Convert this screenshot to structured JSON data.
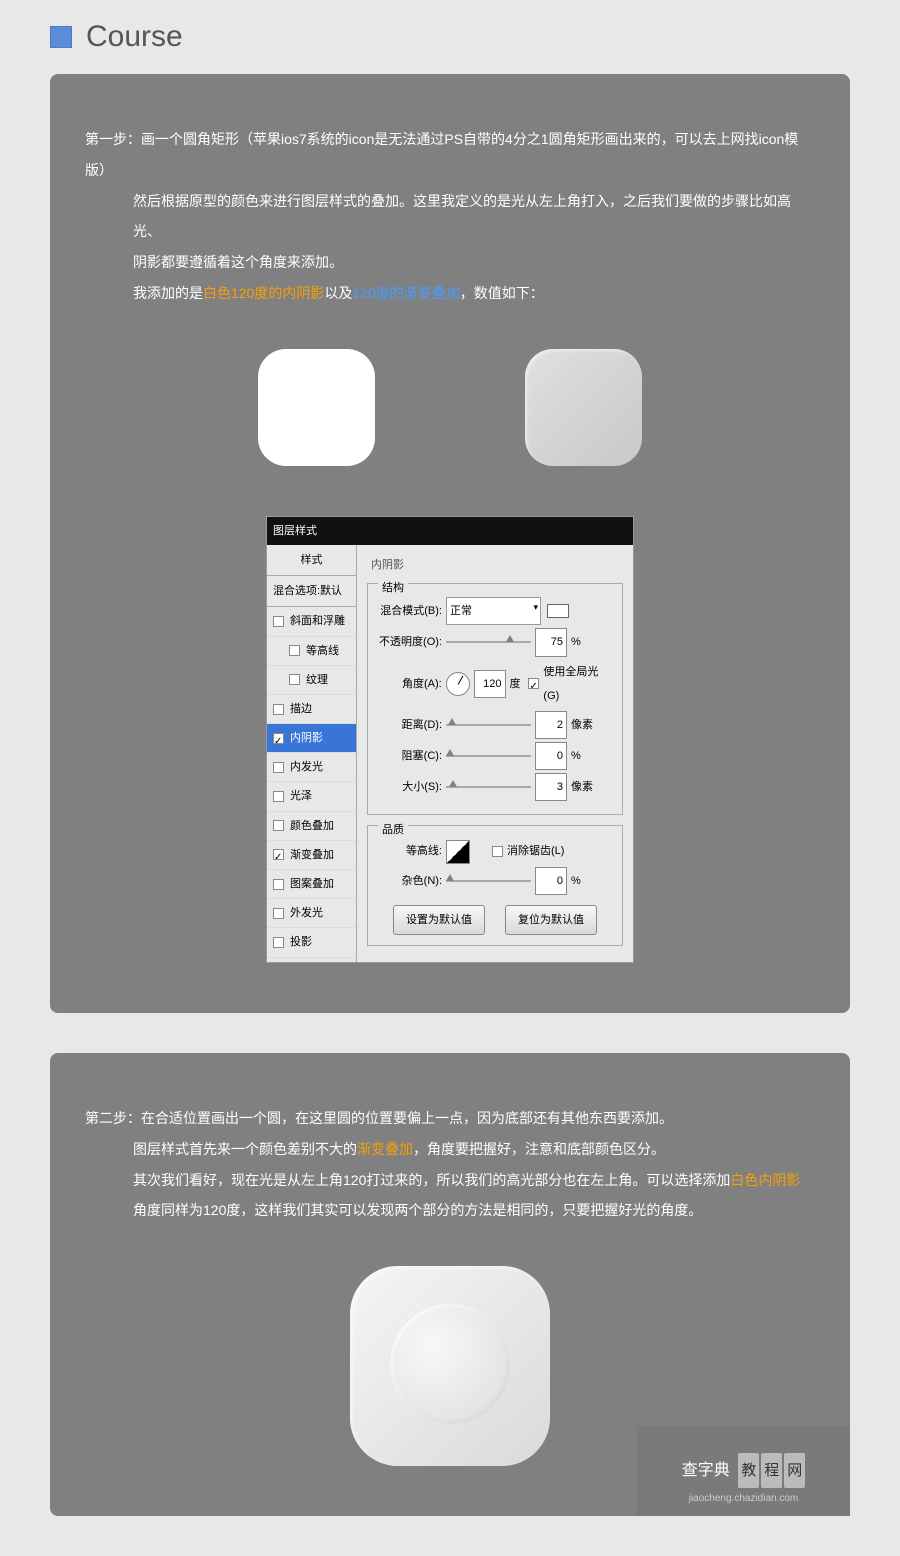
{
  "header": {
    "title": "Course"
  },
  "step1": {
    "line1": "第一步：画一个圆角矩形（苹果ios7系统的icon是无法通过PS自带的4分之1圆角矩形画出来的，可以去上网找icon模版）",
    "line2": "然后根据原型的颜色来进行图层样式的叠加。这里我定义的是光从左上角打入，之后我们要做的步骤比如高光、",
    "line3": "阴影都要遵循着这个角度来添加。",
    "line4_a": "我添加的是",
    "line4_h1": "白色120度的内阴影",
    "line4_b": "以及",
    "line4_h2": "120度的渐变叠加",
    "line4_c": "，数值如下："
  },
  "dialog": {
    "title": "图层样式",
    "styles_header": "样式",
    "blend_opts": "混合选项:默认",
    "styles": [
      {
        "label": "斜面和浮雕",
        "checked": false,
        "active": false
      },
      {
        "label": "等高线",
        "checked": false,
        "active": false
      },
      {
        "label": "纹理",
        "checked": false,
        "active": false
      },
      {
        "label": "描边",
        "checked": false,
        "active": false
      },
      {
        "label": "内阴影",
        "checked": true,
        "active": true
      },
      {
        "label": "内发光",
        "checked": false,
        "active": false
      },
      {
        "label": "光泽",
        "checked": false,
        "active": false
      },
      {
        "label": "颜色叠加",
        "checked": false,
        "active": false
      },
      {
        "label": "渐变叠加",
        "checked": true,
        "active": false
      },
      {
        "label": "图案叠加",
        "checked": false,
        "active": false
      },
      {
        "label": "外发光",
        "checked": false,
        "active": false
      },
      {
        "label": "投影",
        "checked": false,
        "active": false
      }
    ],
    "section_title": "内阴影",
    "group_struct": "结构",
    "blend_mode_label": "混合模式(B):",
    "blend_mode_value": "正常",
    "opacity_label": "不透明度(O):",
    "opacity_value": "75",
    "opacity_unit": "%",
    "angle_label": "角度(A):",
    "angle_value": "120",
    "angle_unit": "度",
    "global_light": "使用全局光(G)",
    "distance_label": "距离(D):",
    "distance_value": "2",
    "distance_unit": "像素",
    "choke_label": "阻塞(C):",
    "choke_value": "0",
    "choke_unit": "%",
    "size_label": "大小(S):",
    "size_value": "3",
    "size_unit": "像素",
    "group_quality": "品质",
    "contour_label": "等高线:",
    "antialias": "消除锯齿(L)",
    "noise_label": "杂色(N):",
    "noise_value": "0",
    "noise_unit": "%",
    "btn_default": "设置为默认值",
    "btn_reset": "复位为默认值"
  },
  "step2": {
    "line1": "第二步：在合适位置画出一个圆，在这里圆的位置要偏上一点，因为底部还有其他东西要添加。",
    "line2_a": "图层样式首先来一个颜色差别不大的",
    "line2_h": "渐变叠加",
    "line2_b": "，角度要把握好，注意和底部颜色区分。",
    "line3_a": "其次我们看好，现在光是从左上角120打过来的，所以我们的高光部分也在左上角。可以选择添加",
    "line3_h": "白色内阴影",
    "line4": "角度同样为120度，这样我们其实可以发现两个部分的方法是相同的，只要把握好光的角度。"
  },
  "watermark": {
    "brand_a": "查字典",
    "brand_b1": "教",
    "brand_b2": "程",
    "brand_b3": "网",
    "url": "jiaocheng.chazidian.com"
  }
}
